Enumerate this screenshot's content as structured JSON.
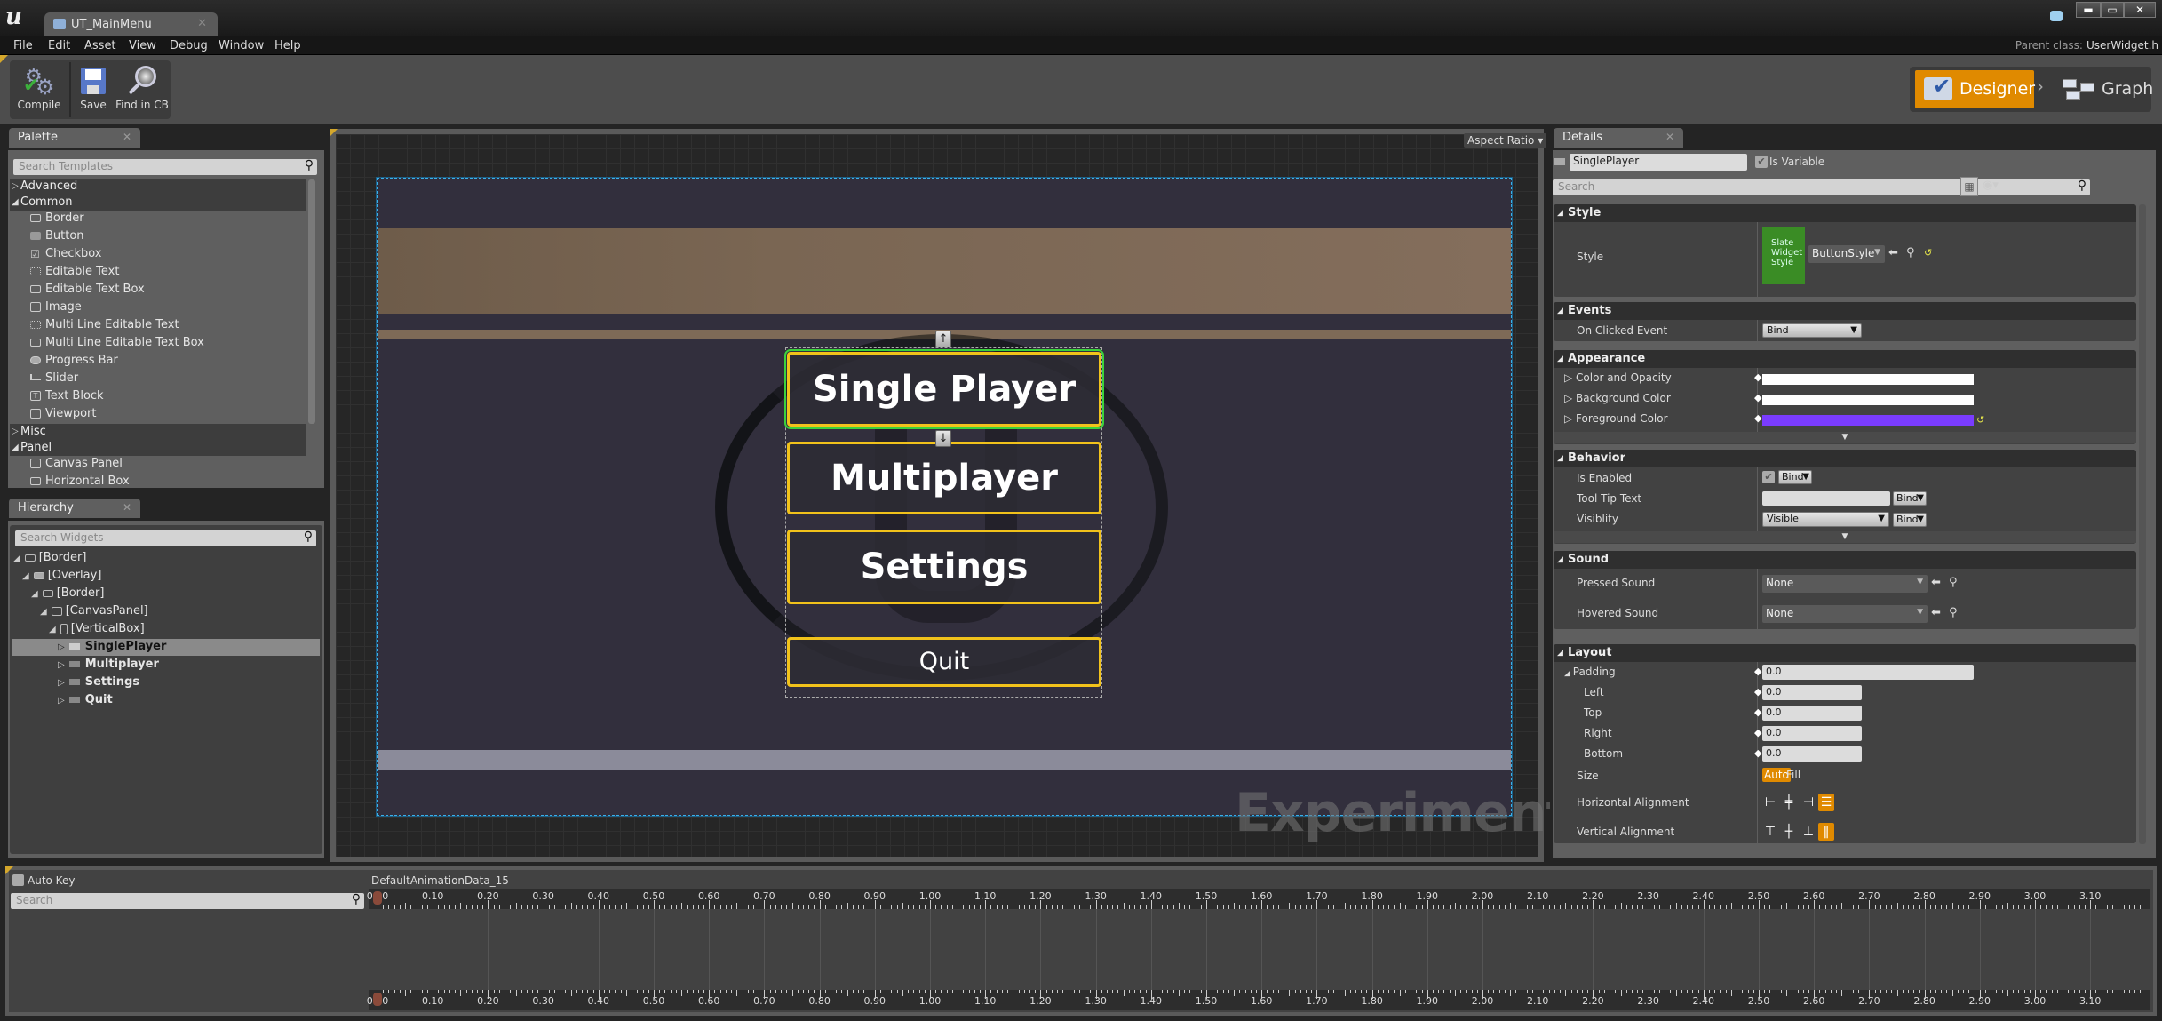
{
  "window": {
    "tab_title": "UT_MainMenu",
    "minimize": "▬",
    "maximize": "▭",
    "close": "✕"
  },
  "menu": [
    "File",
    "Edit",
    "Asset",
    "View",
    "Debug",
    "Window",
    "Help"
  ],
  "parent_class": {
    "label": "Parent class:",
    "value": "UserWidget.h"
  },
  "toolbar": {
    "compile": "Compile",
    "save": "Save",
    "find_in_cb": "Find in CB"
  },
  "modes": {
    "designer": "Designer",
    "graph": "Graph",
    "active": "Designer"
  },
  "palette": {
    "title": "Palette",
    "search_placeholder": "Search Templates",
    "categories": [
      {
        "label": "Advanced",
        "expanded": false
      },
      {
        "label": "Common",
        "expanded": true,
        "items": [
          "Border",
          "Button",
          "Checkbox",
          "Editable Text",
          "Editable Text Box",
          "Image",
          "Multi Line Editable Text",
          "Multi Line Editable Text Box",
          "Progress Bar",
          "Slider",
          "Text Block",
          "Viewport"
        ]
      },
      {
        "label": "Misc",
        "expanded": false
      },
      {
        "label": "Panel",
        "expanded": true,
        "items": [
          "Canvas Panel",
          "Horizontal Box"
        ]
      }
    ]
  },
  "hierarchy": {
    "title": "Hierarchy",
    "search_placeholder": "Search Widgets",
    "nodes": [
      {
        "label": "[Border]",
        "depth": 0
      },
      {
        "label": "[Overlay]",
        "depth": 1
      },
      {
        "label": "[Border]",
        "depth": 2
      },
      {
        "label": "[CanvasPanel]",
        "depth": 3
      },
      {
        "label": "[VerticalBox]",
        "depth": 4
      },
      {
        "label": "SinglePlayer",
        "depth": 5,
        "selected": true
      },
      {
        "label": "Multiplayer",
        "depth": 5
      },
      {
        "label": "Settings",
        "depth": 5
      },
      {
        "label": "Quit",
        "depth": 5
      }
    ]
  },
  "designer": {
    "aspect_ratio": "Aspect Ratio",
    "watermark": "Experimental",
    "buttons": [
      "Single Player",
      "Multiplayer",
      "Settings",
      "Quit"
    ],
    "selected_button": "Single Player",
    "button_border_color": "#f1c21b",
    "selection_color": "#3bd23b"
  },
  "details": {
    "title": "Details",
    "widget_name": "SinglePlayer",
    "is_variable_label": "Is Variable",
    "is_variable": true,
    "search_placeholder": "Search",
    "style": {
      "header": "Style",
      "label": "Style",
      "thumb_text": "Slate Widget Style",
      "value": "ButtonStyle"
    },
    "events": {
      "header": "Events",
      "on_clicked_label": "On Clicked Event",
      "on_clicked_value": "Bind"
    },
    "appearance": {
      "header": "Appearance",
      "rows": [
        {
          "label": "Color and Opacity",
          "color": "#ffffff"
        },
        {
          "label": "Background Color",
          "color": "#ffffff"
        },
        {
          "label": "Foreground Color",
          "color": "#7a3cff"
        }
      ]
    },
    "behavior": {
      "header": "Behavior",
      "is_enabled_label": "Is Enabled",
      "is_enabled": true,
      "tooltip_label": "Tool Tip Text",
      "tooltip_value": "",
      "visibility_label": "Visiblity",
      "visibility_value": "Visible",
      "bind": "Bind"
    },
    "sound": {
      "header": "Sound",
      "pressed_label": "Pressed Sound",
      "pressed_value": "None",
      "hovered_label": "Hovered Sound",
      "hovered_value": "None"
    },
    "layout": {
      "header": "Layout",
      "padding_label": "Padding",
      "padding_value": "0.0",
      "left_label": "Left",
      "left_value": "0.0",
      "top_label": "Top",
      "top_value": "0.0",
      "right_label": "Right",
      "right_value": "0.0",
      "bottom_label": "Bottom",
      "bottom_value": "0.0",
      "size_label": "Size",
      "size_auto": "Auto",
      "size_fill": "Fill",
      "size_selected": "Auto",
      "halign_label": "Horizontal Alignment",
      "halign_selected": "fill",
      "valign_label": "Vertical Alignment",
      "valign_selected": "fill"
    }
  },
  "timeline": {
    "auto_key": "Auto Key",
    "auto_key_checked": false,
    "search_placeholder": "Search",
    "animation_name": "DefaultAnimationData_15",
    "playhead": "0.00",
    "ticks": [
      "0.00",
      "0.10",
      "0.20",
      "0.30",
      "0.40",
      "0.50",
      "0.60",
      "0.70",
      "0.80",
      "0.90",
      "1.00",
      "1.10",
      "1.20",
      "1.30",
      "1.40",
      "1.50",
      "1.60",
      "1.70",
      "1.80",
      "1.90",
      "2.00",
      "2.10",
      "2.20",
      "2.30",
      "2.40",
      "2.50",
      "2.60",
      "2.70",
      "2.80",
      "2.90",
      "3.00",
      "3.10"
    ]
  }
}
